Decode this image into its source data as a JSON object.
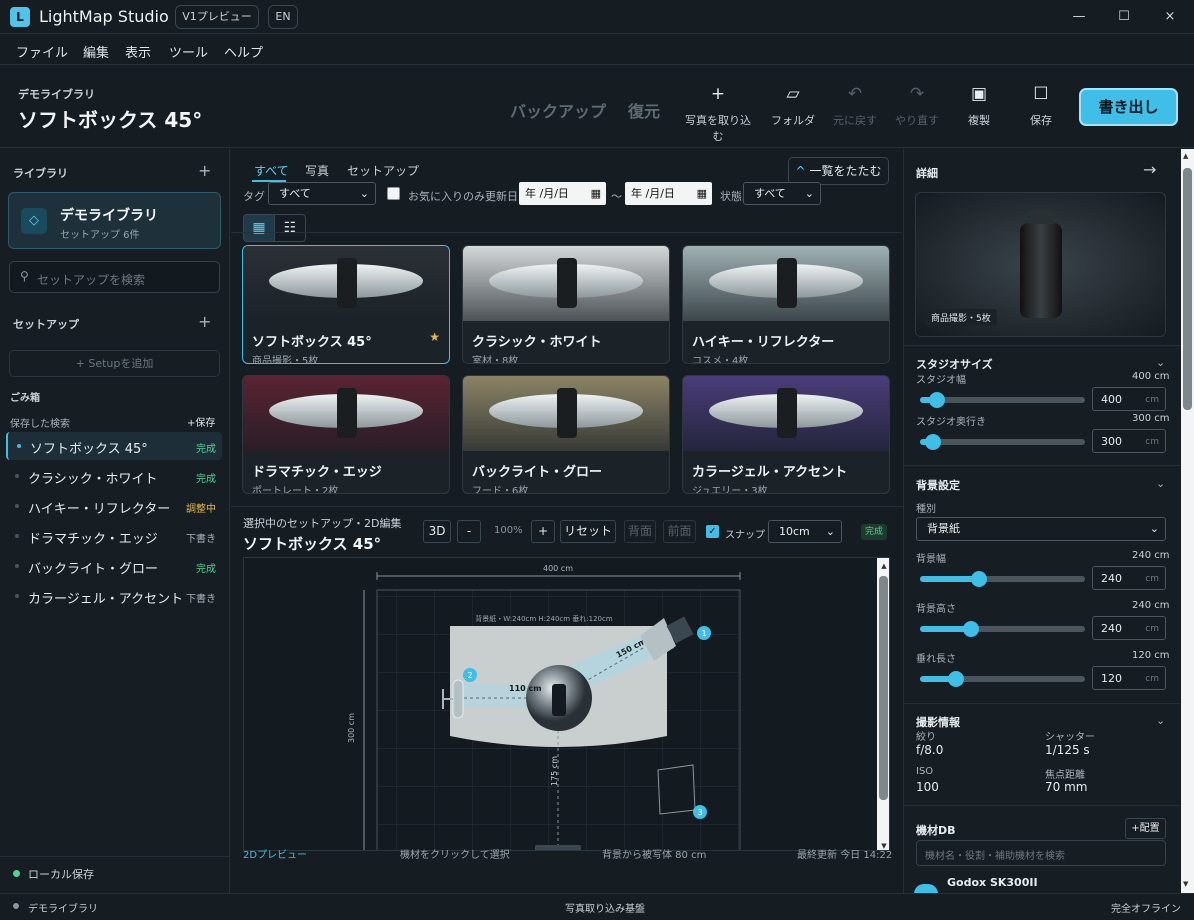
{
  "app": {
    "logo": "L",
    "name": "LightMap Studio",
    "version_badge": "V1プレビュー",
    "lang_badge": "EN",
    "minimize": "—",
    "maximize": "☐",
    "close": "×"
  },
  "menu": [
    "ファイル",
    "編集",
    "表示",
    "ツール",
    "ヘルプ"
  ],
  "header": {
    "library_label": "デモライブラリ",
    "title": "ソフトボックス 45°",
    "backup": "バックアップ",
    "restore": "復元",
    "export": "書き出し",
    "tools": [
      {
        "icon": "plus-icon",
        "glyph": "+",
        "label": "写真を取り込む"
      },
      {
        "icon": "folder-icon",
        "glyph": "▱",
        "label": "フォルダ"
      },
      {
        "icon": "undo-icon",
        "glyph": "↶",
        "label": "元に戻す"
      },
      {
        "icon": "redo-icon",
        "glyph": "↷",
        "label": "やり直す"
      },
      {
        "icon": "duplicate-icon",
        "glyph": "▣",
        "label": "複製"
      },
      {
        "icon": "save-icon",
        "glyph": "☐",
        "label": "保存"
      }
    ]
  },
  "sidebar": {
    "library_heading": "ライブラリ",
    "library_card": {
      "name": "デモライブラリ",
      "count": "セットアップ 6件"
    },
    "search_placeholder": "セットアップを検索",
    "setup_heading": "セットアップ",
    "add_setup": "+ Setupを追加",
    "trash": "ごみ箱",
    "saved_search": "保存した検索",
    "save_btn": "+保存",
    "items": [
      {
        "name": "ソフトボックス 45°",
        "status": "完成",
        "cls": "st-done"
      },
      {
        "name": "クラシック・ホワイト",
        "status": "完成",
        "cls": "st-done"
      },
      {
        "name": "ハイキー・リフレクター",
        "status": "調整中",
        "cls": "st-adj"
      },
      {
        "name": "ドラマチック・エッジ",
        "status": "下書き",
        "cls": "st-draft"
      },
      {
        "name": "バックライト・グロー",
        "status": "完成",
        "cls": "st-done"
      },
      {
        "name": "カラージェル・アクセント",
        "status": "下書き",
        "cls": "st-draft"
      }
    ],
    "local_save": "ローカル保存"
  },
  "browser": {
    "tabs": [
      "すべて",
      "写真",
      "セットアップ"
    ],
    "collapse": "一覧をたたむ",
    "tag_label": "タグ",
    "tag_value": "すべて",
    "fav_label": "お気に入りのみ",
    "updated_label": "更新日",
    "date_from": "年 /月/日",
    "tilde": "〜",
    "date_to": "年 /月/日",
    "state_label": "状態",
    "state_value": "すべて",
    "cards": [
      {
        "title": "ソフトボックス 45°",
        "sub": "商品撮影・5枚",
        "bg": "#2a3036"
      },
      {
        "title": "クラシック・ホワイト",
        "sub": "室材・8枚",
        "bg": "#d4d8d9"
      },
      {
        "title": "ハイキー・リフレクター",
        "sub": "コスメ・4枚",
        "bg": "#9fb0b3"
      },
      {
        "title": "ドラマチック・エッジ",
        "sub": "ポートレート・2枚",
        "bg": "#5a2332"
      },
      {
        "title": "バックライト・グロー",
        "sub": "フード・6枚",
        "bg": "#8c8466"
      },
      {
        "title": "カラージェル・アクセント",
        "sub": "ジュエリー・3枚",
        "bg": "#4a3d7a"
      }
    ]
  },
  "editor": {
    "label": "選択中のセットアップ・2D編集",
    "title": "ソフトボックス 45°",
    "btn_3d": "3D",
    "minus": "-",
    "zoom": "100%",
    "plus": "+",
    "reset": "リセット",
    "back": "背面",
    "front": "前面",
    "snap": "スナップ",
    "grid": "10cm",
    "done": "完成",
    "width_dim": "400 cm",
    "depth_dim": "300 cm",
    "bg_info": "背景紙・W:240cm H:240cm 垂れ:120cm",
    "dist1": "150 cm",
    "dist2": "110 cm",
    "dist3": "175 cm",
    "footer_left": "2Dプレビュー",
    "footer_mid": "機材をクリックして選択",
    "footer_dist": "背景から被写体 80 cm",
    "footer_right": "最終更新 今日 14:22"
  },
  "details": {
    "heading": "詳細",
    "preview_badge": "商品撮影・5枚",
    "studio": {
      "heading": "スタジオサイズ",
      "width_label": "スタジオ幅",
      "width_val": "400 cm",
      "width": "400",
      "depth_label": "スタジオ奥行き",
      "depth_val": "300 cm",
      "depth": "300",
      "unit": "cm"
    },
    "background": {
      "heading": "背景設定",
      "type_label": "種別",
      "type": "背景紙",
      "w_label": "背景幅",
      "w_val": "240 cm",
      "w": "240",
      "h_label": "背景高さ",
      "h_val": "240 cm",
      "h": "240",
      "drop_label": "垂れ長さ",
      "drop_val": "120 cm",
      "drop": "120"
    },
    "shot": {
      "heading": "撮影情報",
      "aperture_label": "絞り",
      "aperture": "f/8.0",
      "shutter_label": "シャッター",
      "shutter": "1/125 s",
      "iso_label": "ISO",
      "iso": "100",
      "focal_label": "焦点距離",
      "focal": "70 mm"
    },
    "gear": {
      "heading": "機材DB",
      "add": "+配置",
      "search_placeholder": "機材名・役割・補助機材を検索",
      "first": "Godox SK300II"
    }
  },
  "slider_levels": {
    "studio_width": 0.1,
    "studio_depth": 0.08,
    "bg_width": 0.36,
    "bg_height": 0.31,
    "drop": 0.22
  },
  "statusbar": {
    "left": "デモライブラリ",
    "mid": "写真取り込み基盤",
    "right": "完全オフライン"
  },
  "colors": {
    "accent": "#3fbfe8",
    "done": "#53d392",
    "adjust": "#e8b84a"
  }
}
